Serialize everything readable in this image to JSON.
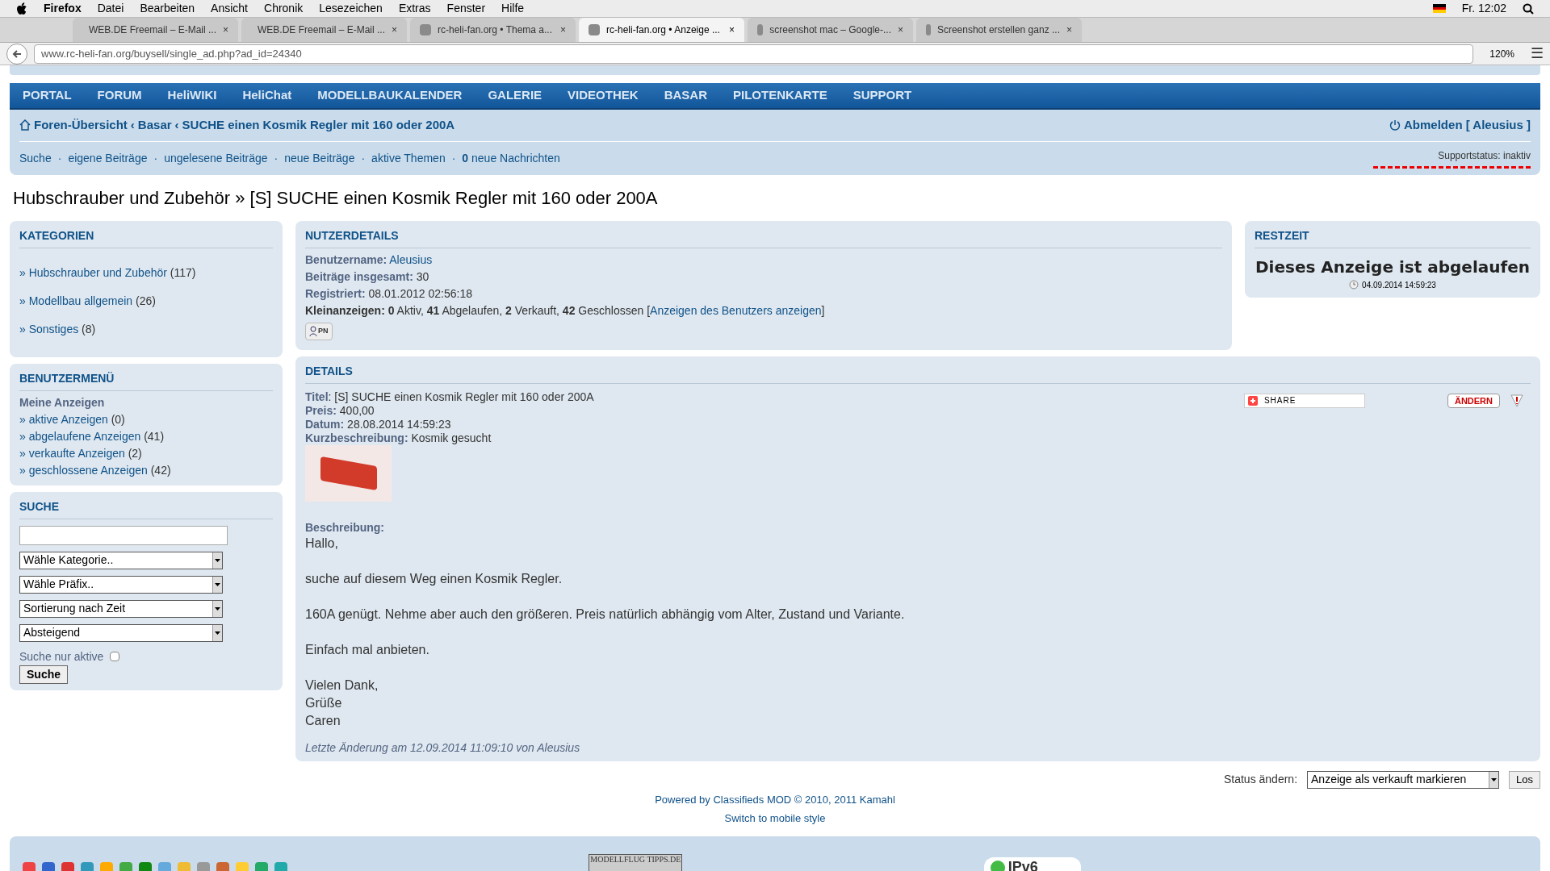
{
  "menubar": {
    "app": "Firefox",
    "menus": [
      "Datei",
      "Bearbeiten",
      "Ansicht",
      "Chronik",
      "Lesezeichen",
      "Extras",
      "Fenster",
      "Hilfe"
    ],
    "clock": "Fr. 12:02"
  },
  "tabs": [
    {
      "label": "WEB.DE Freemail – E-Mail ...",
      "selected": false
    },
    {
      "label": "WEB.DE Freemail – E-Mail ...",
      "selected": false
    },
    {
      "label": "rc-heli-fan.org • Thema a...",
      "selected": false
    },
    {
      "label": "rc-heli-fan.org • Anzeige ...",
      "selected": true
    },
    {
      "label": "screenshot mac – Google-...",
      "selected": false
    },
    {
      "label": "Screenshot erstellen ganz ...",
      "selected": false
    }
  ],
  "address": {
    "url": "www.rc-heli-fan.org/buysell/single_ad.php?ad_id=24340",
    "zoom": "120%"
  },
  "nav": [
    "PORTAL",
    "FORUM",
    "HeliWIKI",
    "HeliChat",
    "MODELLBAUKALENDER",
    "GALERIE",
    "VIDEOTHEK",
    "BASAR",
    "PILOTENKARTE",
    "SUPPORT"
  ],
  "breadcrumb_separator": "‹",
  "quicklink_separator": "·",
  "bullet": "»",
  "tab_close": "×",
  "menu_glyph": "☰",
  "breadcrumbs": [
    "Foren-Übersicht",
    "Basar",
    "SUCHE einen Kosmik Regler mit 160 oder 200A"
  ],
  "logout": "Abmelden [ Aleusius ]",
  "quicklinks": [
    "Suche",
    "eigene Beiträge",
    "ungelesene Beiträge",
    "neue Beiträge",
    "aktive Themen"
  ],
  "messages": "**0** neue Nachrichten",
  "support_status": "Supportstatus: inaktiv",
  "page_title": "Hubschrauber und Zubehör » [S] SUCHE einen Kosmik Regler mit 160 oder 200A",
  "categories": {
    "title": "KATEGORIEN",
    "items": [
      {
        "name": "Hubschrauber und Zubehör",
        "count": "(117)"
      },
      {
        "name": "Modellbau allgemein",
        "count": "(26)"
      },
      {
        "name": "Sonstiges",
        "count": "(8)"
      }
    ]
  },
  "user_menu": {
    "title": "BENUTZERMENÜ",
    "subtitle": "Meine Anzeigen",
    "items": [
      {
        "name": "aktive Anzeigen",
        "count": "(0)"
      },
      {
        "name": "abgelaufene Anzeigen",
        "count": "(41)"
      },
      {
        "name": "verkaufte Anzeigen",
        "count": "(2)"
      },
      {
        "name": "geschlossene Anzeigen",
        "count": "(42)"
      }
    ]
  },
  "search": {
    "title": "SUCHE",
    "selects": [
      "Wähle Kategorie..",
      "Wähle Präfix..",
      "Sortierung nach Zeit",
      "Absteigend"
    ],
    "checkbox": {
      "label": "Suche nur aktive",
      "checked": false
    },
    "button": "Suche"
  },
  "user_details": {
    "title": "NUTZERDETAILS",
    "rows": [
      {
        "label": "Benutzername:",
        "value": "Aleusius",
        "link": true
      },
      {
        "label": "Beiträge insgesamt:",
        "value": "30",
        "link": false
      },
      {
        "label": "Registriert:",
        "value": "08.01.2012 02:56:18",
        "link": false
      }
    ],
    "ads": "**Kleinanzeigen:** **0** Aktiv, **41** Abgelaufen, **2** Verkauft, **42** Geschlossen [",
    "ads_link": "Anzeigen des Benutzers anzeigen",
    "ads_end": "]",
    "pm": "PN"
  },
  "remaining": {
    "title": "RESTZEIT",
    "message": "Dieses Anzeige ist abgelaufen",
    "date": "04.09.2014 14:59:23"
  },
  "details": {
    "title": "DETAILS",
    "fields": [
      {
        "label": "Titel",
        "value": ": [S] SUCHE einen Kosmik Regler mit 160 oder 200A"
      },
      {
        "label": "Preis:",
        "value": " 400,00"
      },
      {
        "label": "Datum:",
        "value": " 28.08.2014 14:59:23"
      },
      {
        "label": "Kurzbeschreibung:",
        "value": " Kosmik gesucht"
      }
    ],
    "share": "SHARE",
    "edit": "ÄNDERN",
    "description_label": "Beschreibung:",
    "paragraphs": [
      [
        "Hallo,"
      ],
      [
        "suche auf diesem Weg einen Kosmik Regler."
      ],
      [
        "160A genügt. Nehme aber auch den größeren. Preis natürlich abhängig vom Alter, Zustand und Variante."
      ],
      [
        "Einfach mal anbieten."
      ],
      [
        "Vielen Dank,",
        "Grüße",
        "Caren"
      ]
    ],
    "last_change": "Letzte Änderung am 12.09.2014 11:09:10 von Aleusius"
  },
  "status": {
    "label": "Status ändern:",
    "option": "Anzeige als verkauft markieren",
    "button": "Los"
  },
  "footer": {
    "powered": "Powered by",
    "powered_link": "Classifieds MOD",
    "copyright": "© 2010, 2011",
    "author": "Kamahl",
    "mobile": "Switch to mobile style",
    "logo": "MODELLFLUG TIPPS.DE",
    "badge": "IPv6"
  }
}
